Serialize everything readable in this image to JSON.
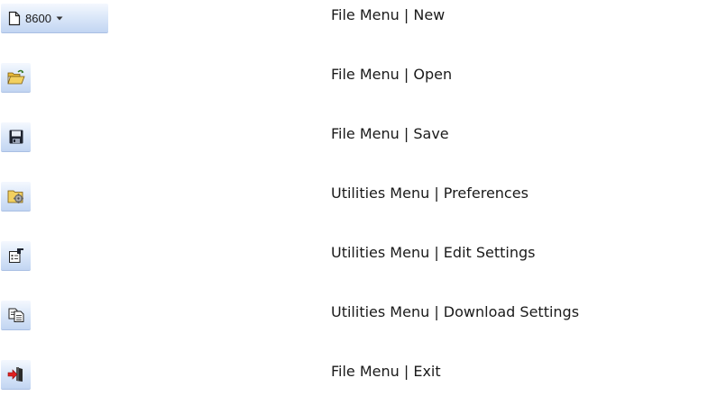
{
  "rows": [
    {
      "icon": "new-document-icon",
      "button_label": "8600",
      "description": "File Menu | New"
    },
    {
      "icon": "open-folder-icon",
      "description": "File Menu | Open"
    },
    {
      "icon": "floppy-disk-save-icon",
      "description": "File Menu | Save"
    },
    {
      "icon": "folder-gear-preferences-icon",
      "description": "Utilities Menu | Preferences"
    },
    {
      "icon": "edit-properties-icon",
      "description": "Utilities Menu | Edit Settings"
    },
    {
      "icon": "copy-documents-download-icon",
      "description": "Utilities Menu | Download Settings"
    },
    {
      "icon": "door-exit-icon",
      "description": "File Menu | Exit"
    }
  ],
  "colors": {
    "button_top": "#f4f8fe",
    "button_bottom": "#c2d5f2",
    "folder_yellow": "#f2d060",
    "save_dark": "#1f2430",
    "exit_red": "#e02020",
    "text": "#1a1a1a"
  }
}
